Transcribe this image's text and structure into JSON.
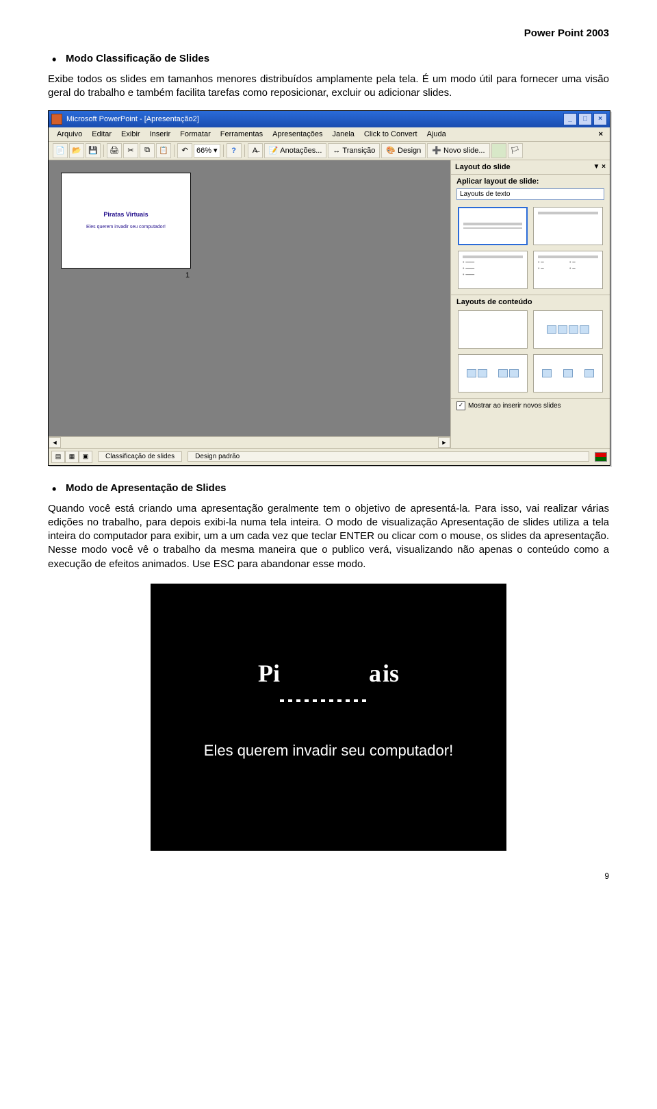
{
  "header": {
    "product": "Power Point 2003"
  },
  "section1": {
    "title": "Modo Classificação de Slides",
    "body": "Exibe todos os slides em tamanhos menores distribuídos amplamente pela tela. É um modo útil para fornecer uma visão geral do trabalho e também facilita tarefas como reposicionar, excluir ou adicionar slides."
  },
  "pp": {
    "title": "Microsoft PowerPoint - [Apresentação2]",
    "menus": [
      "Arquivo",
      "Editar",
      "Exibir",
      "Inserir",
      "Formatar",
      "Ferramentas",
      "Apresentações",
      "Janela",
      "Click to Convert",
      "Ajuda"
    ],
    "zoom": "66%",
    "tb_annotations": "Anotações...",
    "tb_transition": "Transição",
    "tb_design": "Design",
    "tb_newslide": "Novo slide...",
    "slide": {
      "title": "Piratas Virtuais",
      "subtitle": "Eles querem invadir seu computador!",
      "number": "1"
    },
    "taskpane": {
      "header": "Layout do slide",
      "apply": "Aplicar layout de slide:",
      "select": "Layouts de texto",
      "content_section": "Layouts de conteúdo",
      "showcheck": "Mostrar ao inserir novos slides"
    },
    "status": {
      "mode": "Classificação de slides",
      "design": "Design padrão"
    }
  },
  "section2": {
    "title": "Modo de Apresentação de Slides",
    "body": "Quando você está criando uma apresentação geralmente tem o objetivo de apresentá-la. Para isso, vai realizar várias edições no trabalho, para depois exibi-la numa tela inteira. O modo de visualização Apresentação de slides utiliza a tela inteira do computador para exibir, um a um cada vez que teclar ENTER ou clicar com o mouse, os slides da apresentação. Nesse modo você vê o trabalho da mesma maneira que o publico verá, visualizando não apenas o conteúdo como a execução de efeitos animados. Use ESC para abandonar esse modo."
  },
  "slideshow": {
    "subtitle": "Eles querem invadir seu computador!"
  },
  "pagenum": "9"
}
